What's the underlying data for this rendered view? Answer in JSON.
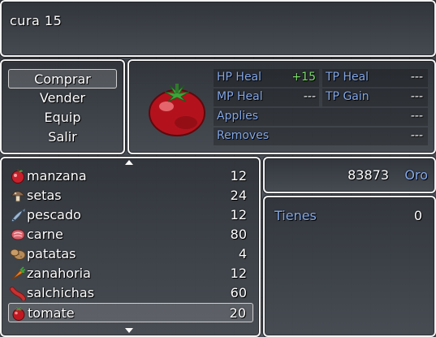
{
  "help": {
    "text": "cura 15"
  },
  "commands": [
    "Comprar",
    "Vender",
    "Equip",
    "Salir"
  ],
  "selected_command": "Comprar",
  "status": {
    "hp_heal_label": "HP Heal",
    "hp_heal_value": "+15",
    "tp_heal_label": "TP Heal",
    "tp_heal_value": "---",
    "mp_heal_label": "MP Heal",
    "mp_heal_value": "---",
    "tp_gain_label": "TP Gain",
    "tp_gain_value": "---",
    "applies_label": "Applies",
    "applies_value": "---",
    "removes_label": "Removes",
    "removes_value": "---",
    "positive_color": "#7ce06a",
    "label_color": "#84a8e8"
  },
  "items": [
    {
      "name": "manzana",
      "qty": "12",
      "icon": "apple-icon"
    },
    {
      "name": "setas",
      "qty": "24",
      "icon": "mushroom-icon"
    },
    {
      "name": "pescado",
      "qty": "12",
      "icon": "fish-icon"
    },
    {
      "name": "carne",
      "qty": "80",
      "icon": "meat-icon"
    },
    {
      "name": "patatas",
      "qty": "4",
      "icon": "potato-icon"
    },
    {
      "name": "zanahoria",
      "qty": "12",
      "icon": "carrot-icon"
    },
    {
      "name": "salchichas",
      "qty": "60",
      "icon": "sausage-icon"
    },
    {
      "name": "tomate",
      "qty": "20",
      "icon": "tomato-icon"
    }
  ],
  "selected_item": "tomate",
  "gold": {
    "amount": "83873",
    "currency": "Oro"
  },
  "possession": {
    "label": "Tienes",
    "value": "0"
  }
}
